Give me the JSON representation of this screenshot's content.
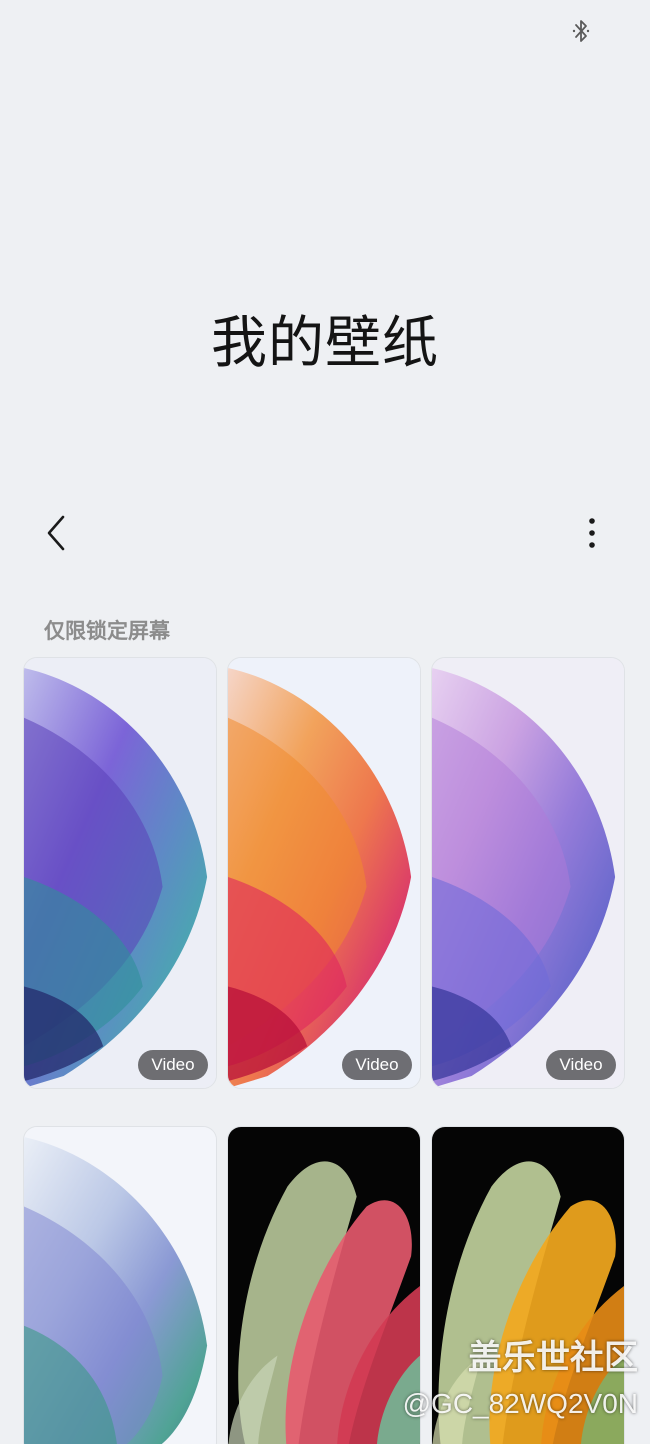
{
  "status_bar": {
    "icons": [
      "bluetooth-icon"
    ]
  },
  "header": {
    "title": "我的壁纸"
  },
  "toolbar": {
    "back_icon": "chevron-left-icon",
    "more_icon": "more-vertical-icon"
  },
  "section": {
    "label": "仅限锁定屏幕"
  },
  "wallpapers": [
    {
      "badge": "Video",
      "palette": "blue-purple"
    },
    {
      "badge": "Video",
      "palette": "orange-red"
    },
    {
      "badge": "Video",
      "palette": "lavender-purple"
    },
    {
      "badge": "",
      "palette": "teal-silver"
    },
    {
      "badge": "",
      "palette": "dark-coral"
    },
    {
      "badge": "",
      "palette": "dark-gold"
    }
  ],
  "watermark": {
    "line1": "盖乐世社区",
    "line2": "@GC_82WQ2V0N"
  },
  "colors": {
    "background": "#eef0f3",
    "title_text": "#141414",
    "section_label": "#8c8c8c",
    "badge_background": "#58585c"
  }
}
